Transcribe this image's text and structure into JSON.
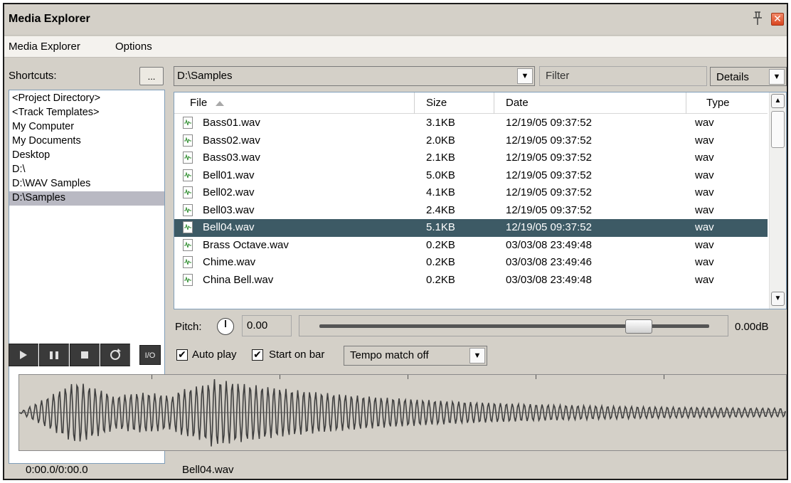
{
  "window": {
    "title": "Media Explorer"
  },
  "menu": [
    "Media Explorer",
    "Options"
  ],
  "shortcuts": {
    "label": "Shortcuts:",
    "button_label": "...",
    "items": [
      "<Project Directory>",
      "<Track Templates>",
      "My Computer",
      "My Documents",
      "Desktop",
      "D:\\",
      "D:\\WAV Samples",
      "D:\\Samples"
    ],
    "selected": "D:\\Samples"
  },
  "path": {
    "value": "D:\\Samples"
  },
  "filter": {
    "placeholder": "Filter"
  },
  "view_mode": {
    "value": "Details"
  },
  "table": {
    "headers": {
      "file": "File",
      "size": "Size",
      "date": "Date",
      "type": "Type"
    },
    "sorted_by": "File",
    "sort_direction": "ascending",
    "rows": [
      {
        "file": "Bass01.wav",
        "size": "3.1KB",
        "date": "12/19/05 09:37:52",
        "type": "wav"
      },
      {
        "file": "Bass02.wav",
        "size": "2.0KB",
        "date": "12/19/05 09:37:52",
        "type": "wav"
      },
      {
        "file": "Bass03.wav",
        "size": "2.1KB",
        "date": "12/19/05 09:37:52",
        "type": "wav"
      },
      {
        "file": "Bell01.wav",
        "size": "5.0KB",
        "date": "12/19/05 09:37:52",
        "type": "wav"
      },
      {
        "file": "Bell02.wav",
        "size": "4.1KB",
        "date": "12/19/05 09:37:52",
        "type": "wav"
      },
      {
        "file": "Bell03.wav",
        "size": "2.4KB",
        "date": "12/19/05 09:37:52",
        "type": "wav"
      },
      {
        "file": "Bell04.wav",
        "size": "5.1KB",
        "date": "12/19/05 09:37:52",
        "type": "wav"
      },
      {
        "file": "Brass Octave.wav",
        "size": "0.2KB",
        "date": "03/03/08 23:49:48",
        "type": "wav"
      },
      {
        "file": "Chime.wav",
        "size": "0.2KB",
        "date": "03/03/08 23:49:46",
        "type": "wav"
      },
      {
        "file": "China Bell.wav",
        "size": "0.2KB",
        "date": "03/03/08 23:49:48",
        "type": "wav"
      }
    ],
    "selected_file": "Bell04.wav"
  },
  "pitch": {
    "label": "Pitch:",
    "value": "0.00"
  },
  "volume": {
    "label": "0.00dB",
    "level_fraction": 0.82
  },
  "transport": {
    "io_label": "I/O"
  },
  "options": {
    "auto_play_label": "Auto play",
    "auto_play_checked": true,
    "start_on_bar_label": "Start on bar",
    "start_on_bar_checked": true,
    "tempo_value": "Tempo match off"
  },
  "status": {
    "time": "0:00.0/0:00.0",
    "file": "Bell04.wav"
  },
  "colors": {
    "selection": "#3d5a65",
    "window_bg": "#d4d0c8",
    "waveform": "#3f3f3f"
  }
}
